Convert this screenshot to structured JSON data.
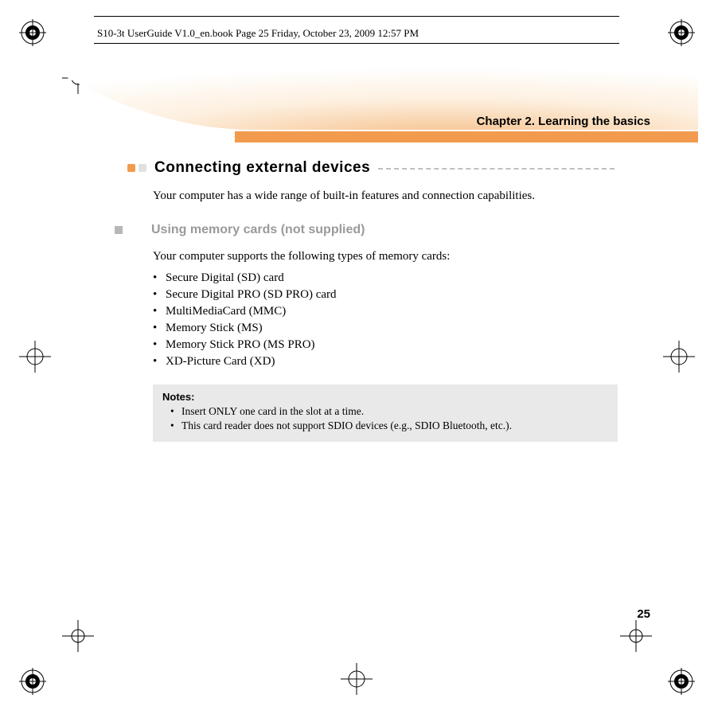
{
  "header_strip": "S10-3t UserGuide V1.0_en.book  Page 25  Friday, October 23, 2009  12:57 PM",
  "chapter_title": "Chapter 2. Learning the basics",
  "section_title": "Connecting external devices",
  "intro": "Your computer has a wide range of built-in features and connection capabilities.",
  "sub_title": "Using memory cards (not supplied)",
  "support_line": "Your computer supports the following types of memory cards:",
  "cards": [
    "Secure Digital (SD) card",
    "Secure Digital PRO (SD PRO) card",
    "MultiMediaCard (MMC)",
    "Memory Stick (MS)",
    "Memory Stick PRO (MS PRO)",
    "XD-Picture Card (XD)"
  ],
  "notes_title": "Notes:",
  "notes_items": [
    "Insert ONLY one card in the slot at a time.",
    "This card reader does not support SDIO devices (e.g., SDIO Bluetooth, etc.)."
  ],
  "page_number": "25"
}
